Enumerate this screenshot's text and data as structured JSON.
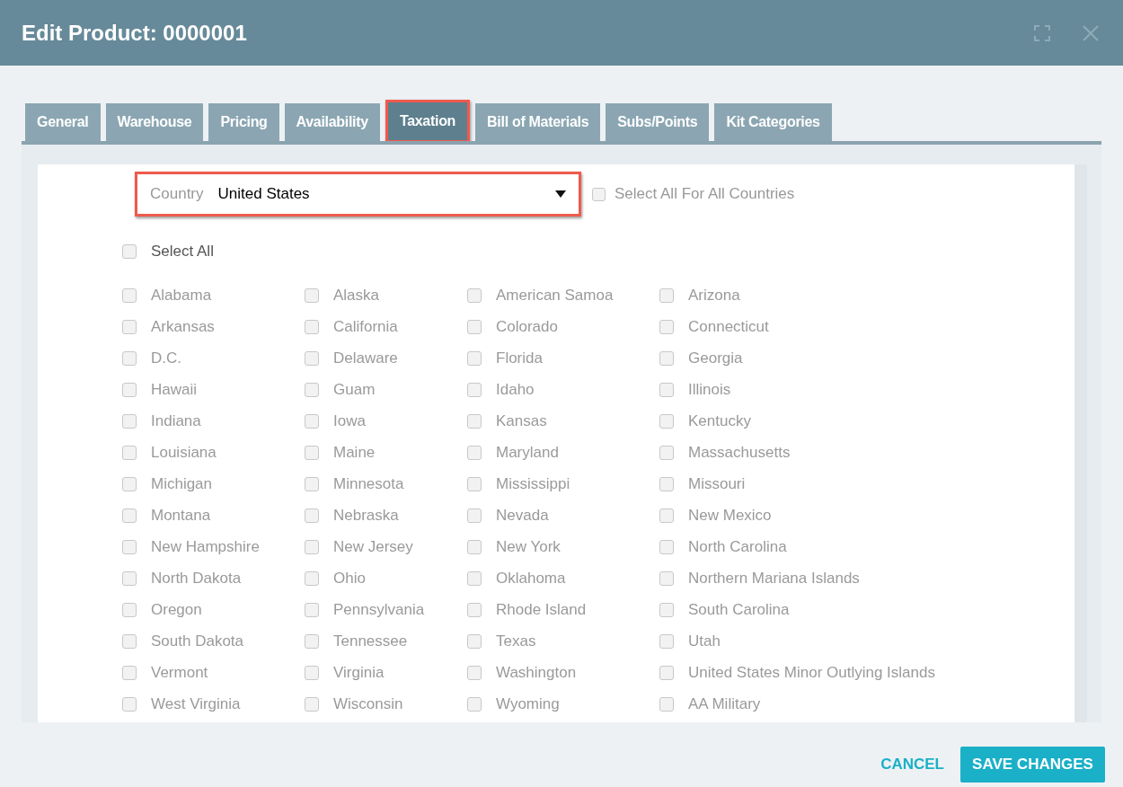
{
  "window": {
    "title": "Edit Product: 0000001"
  },
  "tabs": [
    {
      "label": "General",
      "selected": false,
      "highlighted": false
    },
    {
      "label": "Warehouse",
      "selected": false,
      "highlighted": false
    },
    {
      "label": "Pricing",
      "selected": false,
      "highlighted": false
    },
    {
      "label": "Availability",
      "selected": false,
      "highlighted": false
    },
    {
      "label": "Taxation",
      "selected": true,
      "highlighted": true
    },
    {
      "label": "Bill of Materials",
      "selected": false,
      "highlighted": false
    },
    {
      "label": "Subs/Points",
      "selected": false,
      "highlighted": false
    },
    {
      "label": "Kit Categories",
      "selected": false,
      "highlighted": false
    }
  ],
  "country": {
    "label": "Country",
    "value": "United States",
    "highlighted": true
  },
  "select_all_countries": {
    "label": "Select All For All Countries",
    "checked": false
  },
  "select_all": {
    "label": "Select All",
    "checked": false
  },
  "states": [
    {
      "label": "Alabama",
      "checked": false
    },
    {
      "label": "Alaska",
      "checked": false
    },
    {
      "label": "American Samoa",
      "checked": false
    },
    {
      "label": "Arizona",
      "checked": false
    },
    {
      "label": "Arkansas",
      "checked": false
    },
    {
      "label": "California",
      "checked": false
    },
    {
      "label": "Colorado",
      "checked": false
    },
    {
      "label": "Connecticut",
      "checked": false
    },
    {
      "label": "D.C.",
      "checked": false
    },
    {
      "label": "Delaware",
      "checked": false
    },
    {
      "label": "Florida",
      "checked": false
    },
    {
      "label": "Georgia",
      "checked": false
    },
    {
      "label": "Hawaii",
      "checked": false
    },
    {
      "label": "Guam",
      "checked": false
    },
    {
      "label": "Idaho",
      "checked": false
    },
    {
      "label": "Illinois",
      "checked": false
    },
    {
      "label": "Indiana",
      "checked": false
    },
    {
      "label": "Iowa",
      "checked": false
    },
    {
      "label": "Kansas",
      "checked": false
    },
    {
      "label": "Kentucky",
      "checked": false
    },
    {
      "label": "Louisiana",
      "checked": false
    },
    {
      "label": "Maine",
      "checked": false
    },
    {
      "label": "Maryland",
      "checked": false
    },
    {
      "label": "Massachusetts",
      "checked": false
    },
    {
      "label": "Michigan",
      "checked": false
    },
    {
      "label": "Minnesota",
      "checked": false
    },
    {
      "label": "Mississippi",
      "checked": false
    },
    {
      "label": "Missouri",
      "checked": false
    },
    {
      "label": "Montana",
      "checked": false
    },
    {
      "label": "Nebraska",
      "checked": false
    },
    {
      "label": "Nevada",
      "checked": false
    },
    {
      "label": "New Mexico",
      "checked": false
    },
    {
      "label": "New Hampshire",
      "checked": false
    },
    {
      "label": "New Jersey",
      "checked": false
    },
    {
      "label": "New York",
      "checked": false
    },
    {
      "label": "North Carolina",
      "checked": false
    },
    {
      "label": "North Dakota",
      "checked": false
    },
    {
      "label": "Ohio",
      "checked": false
    },
    {
      "label": "Oklahoma",
      "checked": false
    },
    {
      "label": "Northern Mariana Islands",
      "checked": false
    },
    {
      "label": "Oregon",
      "checked": false
    },
    {
      "label": "Pennsylvania",
      "checked": false
    },
    {
      "label": "Rhode Island",
      "checked": false
    },
    {
      "label": "South Carolina",
      "checked": false
    },
    {
      "label": "South Dakota",
      "checked": false
    },
    {
      "label": "Tennessee",
      "checked": false
    },
    {
      "label": "Texas",
      "checked": false
    },
    {
      "label": "Utah",
      "checked": false
    },
    {
      "label": "Vermont",
      "checked": false
    },
    {
      "label": "Virginia",
      "checked": false
    },
    {
      "label": "Washington",
      "checked": false
    },
    {
      "label": "United States Minor Outlying Islands",
      "checked": false
    },
    {
      "label": "West Virginia",
      "checked": false
    },
    {
      "label": "Wisconsin",
      "checked": false
    },
    {
      "label": "Wyoming",
      "checked": false
    },
    {
      "label": "AA Military",
      "checked": false
    }
  ],
  "buttons": {
    "cancel": "CANCEL",
    "save": "SAVE CHANGES"
  }
}
